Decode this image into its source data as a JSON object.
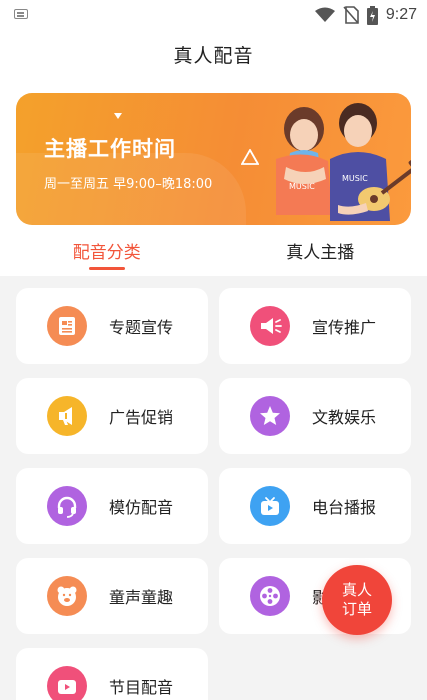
{
  "status": {
    "time": "9:27"
  },
  "header": {
    "title": "真人配音"
  },
  "banner": {
    "title": "主播工作时间",
    "subtitle": "周一至周五 早9:00–晚18:00",
    "shirt_text_left": "MUSIC",
    "shirt_text_right": "MUSIC"
  },
  "tabs": [
    {
      "label": "配音分类",
      "active": true
    },
    {
      "label": "真人主播",
      "active": false
    }
  ],
  "categories": [
    {
      "label": "专题宣传",
      "icon": "document-icon",
      "color": "#f58c54"
    },
    {
      "label": "宣传推广",
      "icon": "megaphone-icon",
      "color": "#f0507a"
    },
    {
      "label": "广告促销",
      "icon": "loudspeaker-icon",
      "color": "#f6b52a"
    },
    {
      "label": "文教娱乐",
      "icon": "star-icon",
      "color": "#b063e0"
    },
    {
      "label": "模仿配音",
      "icon": "headset-icon",
      "color": "#b063e0"
    },
    {
      "label": "电台播报",
      "icon": "tv-icon",
      "color": "#3ea2f2"
    },
    {
      "label": "童声童趣",
      "icon": "bear-icon",
      "color": "#f58c54"
    },
    {
      "label": "影视配音",
      "icon": "film-reel-icon",
      "color": "#b063e0"
    },
    {
      "label": "节目配音",
      "icon": "program-icon",
      "color": "#f0507a"
    }
  ],
  "fab": {
    "label": "真人订单"
  },
  "colors": {
    "accent": "#f2553a",
    "banner": "#f58d35",
    "background": "#f3f3f3"
  }
}
